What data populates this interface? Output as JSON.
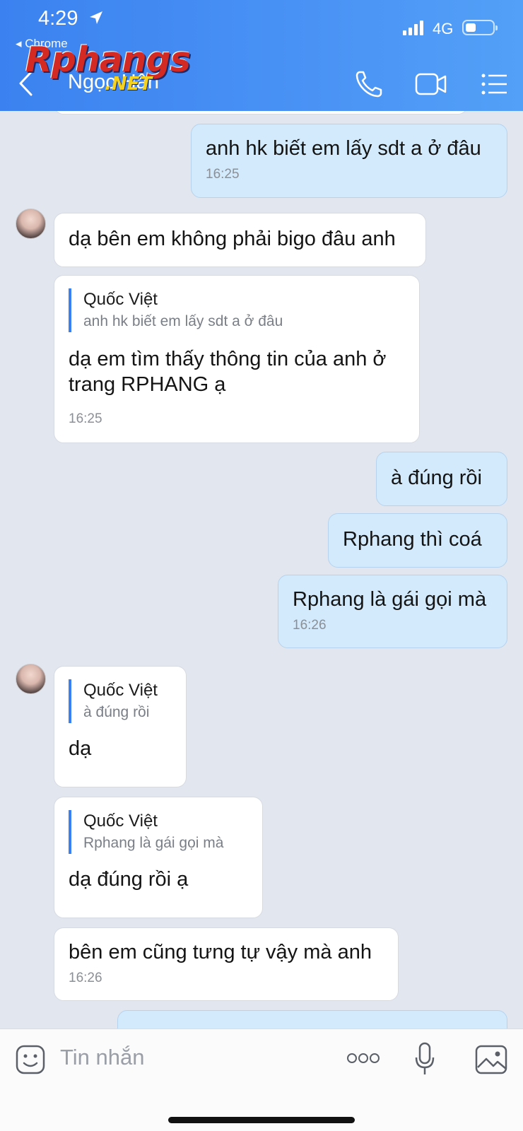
{
  "status_bar": {
    "time": "4:29",
    "back_app": "◂ Chrome",
    "network": "4G"
  },
  "header": {
    "contact_name": "Ngọc Hân"
  },
  "watermark": {
    "main": "Rphangs",
    "suffix": ".NET"
  },
  "messages": {
    "m1": {
      "text": "anh hk biết em lấy sdt a ở đâu",
      "time": "16:25"
    },
    "m2": {
      "text": "dạ bên em không phải bigo đâu anh"
    },
    "m3": {
      "reply_name": "Quốc Việt",
      "reply_text": "anh hk biết em lấy sdt a ở đâu",
      "text": "dạ em tìm thấy thông tin của anh ở trang RPHANG  ạ",
      "time": "16:25"
    },
    "m4": {
      "text": "à đúng rồi"
    },
    "m5": {
      "text": "Rphang thì coá"
    },
    "m6": {
      "text": "Rphang là gái gọi mà",
      "time": "16:26"
    },
    "m7": {
      "reply_name": "Quốc Việt",
      "reply_text": "à đúng rồi",
      "text": "dạ"
    },
    "m8": {
      "reply_name": "Quốc Việt",
      "reply_text": "Rphang là gái gọi mà",
      "text": "dạ đúng rồi ạ"
    },
    "m9": {
      "text": "bên em cũng tưng tự vậy mà anh",
      "time": "16:26"
    }
  },
  "input": {
    "placeholder": "Tin nhắn"
  },
  "colors": {
    "header": "#4a93f5",
    "outgoing_bubble": "#d3eafc",
    "incoming_bubble": "#ffffff",
    "chat_bg": "#e2e6ee",
    "quote_bar": "#3a80ee"
  }
}
